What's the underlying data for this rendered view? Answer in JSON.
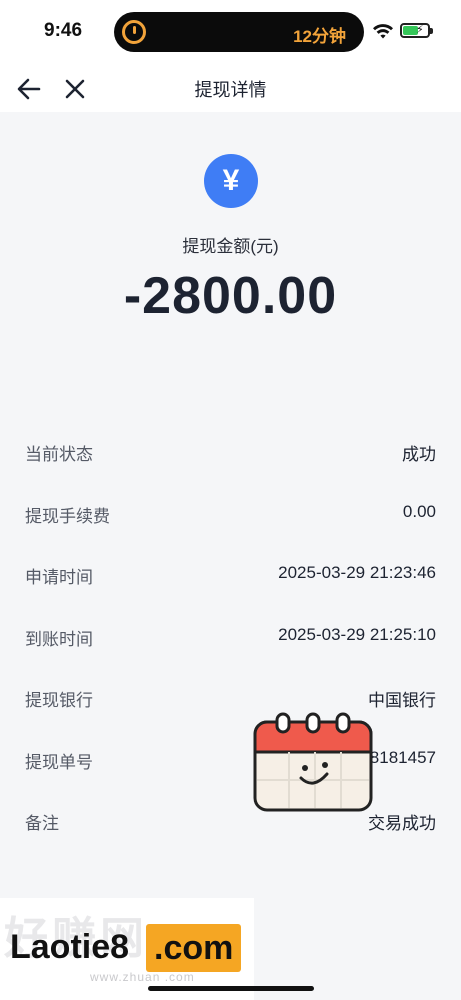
{
  "status_bar": {
    "time": "9:46",
    "island_text": "12分钟",
    "icons": [
      "timer-icon",
      "wifi-icon",
      "battery-charging-icon"
    ]
  },
  "nav": {
    "title": "提现详情",
    "back_icon": "arrow-left-icon",
    "close_icon": "close-icon"
  },
  "hero": {
    "icon_glyph": "¥",
    "label": "提现金额(元)",
    "amount": "-2800.00",
    "accent_color": "#3f7df5"
  },
  "details": [
    {
      "label": "当前状态",
      "value": "成功"
    },
    {
      "label": "提现手续费",
      "value": "0.00"
    },
    {
      "label": "申请时间",
      "value": "2025-03-29 21:23:46"
    },
    {
      "label": "到账时间",
      "value": "2025-03-29 21:25:10"
    },
    {
      "label": "提现银行",
      "value": "中国银行"
    },
    {
      "label": "提现单号",
      "value": "10                    8181457"
    },
    {
      "label": "备注",
      "value": "交易成功"
    }
  ],
  "watermark": {
    "left_text": "Laotie8",
    "right_text": ".com",
    "url_text": "www.zhuan       .com"
  }
}
